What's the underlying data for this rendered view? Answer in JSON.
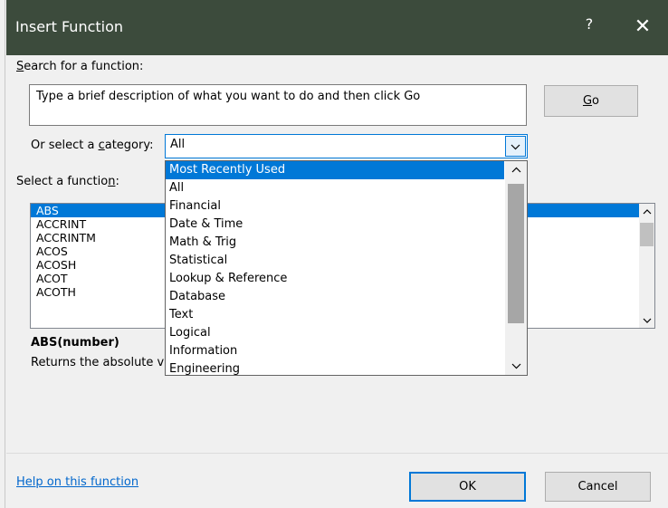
{
  "dialog": {
    "title": "Insert Function",
    "help_glyph": "?",
    "close_glyph": "✕"
  },
  "search": {
    "label_pre": "",
    "label_key": "S",
    "label_post": "earch for a function:",
    "value": "Type a brief description of what you want to do and then click Go",
    "go_key": "G",
    "go_post": "o"
  },
  "category": {
    "label_pre": "Or select a ",
    "label_key": "c",
    "label_post": "ategory:",
    "selected": "All",
    "options": [
      "Most Recently Used",
      "All",
      "Financial",
      "Date & Time",
      "Math & Trig",
      "Statistical",
      "Lookup & Reference",
      "Database",
      "Text",
      "Logical",
      "Information",
      "Engineering"
    ],
    "highlighted_index": 0
  },
  "functions": {
    "label_pre": "Select a functio",
    "label_key": "n",
    "label_post": ":",
    "items": [
      "ABS",
      "ACCRINT",
      "ACCRINTM",
      "ACOS",
      "ACOSH",
      "ACOT",
      "ACOTH"
    ],
    "selected_index": 0
  },
  "details": {
    "signature": "ABS(number)",
    "description": "Returns the absolute value of a number, a number without its sign."
  },
  "footer": {
    "help_link": "Help on this function",
    "ok_label": "OK",
    "cancel_label": "Cancel"
  },
  "colors": {
    "titlebar": "#3c4b3c",
    "accent": "#0078d7",
    "link": "#0066cc"
  }
}
